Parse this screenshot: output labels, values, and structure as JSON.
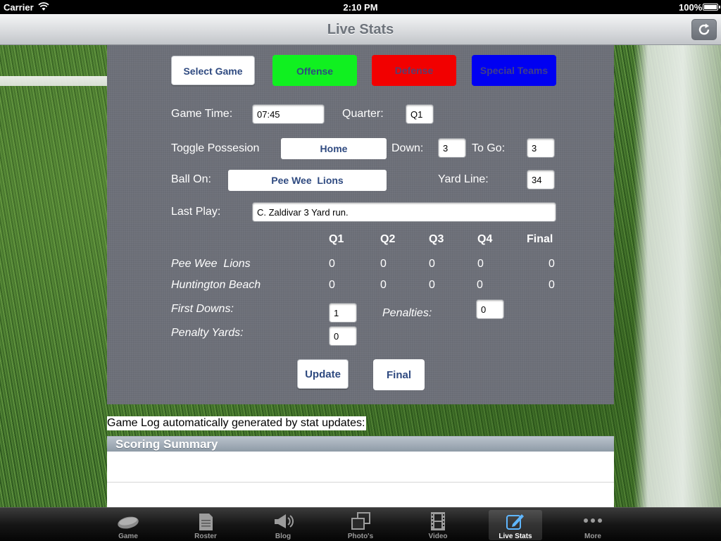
{
  "status_bar": {
    "carrier": "Carrier",
    "time": "2:10 PM",
    "battery": "100%"
  },
  "nav": {
    "title": "Live Stats",
    "refresh_icon": "refresh-icon"
  },
  "top_buttons": {
    "select_game": "Select Game",
    "offense": "Offense",
    "defense": "Defense",
    "special_teams": "Special Teams"
  },
  "colors": {
    "offense": "#10f020",
    "defense": "#f20000",
    "special_teams": "#0000f2"
  },
  "game_info": {
    "game_time_label": "Game Time:",
    "game_time_value": "07:45",
    "quarter_label": "Quarter:",
    "quarter_value": "Q1",
    "possession_label": "Toggle Possesion",
    "possession_value": "Home",
    "down_label": "Down:",
    "down_value": "3",
    "to_go_label": "To Go:",
    "to_go_value": "3",
    "ball_on_label": "Ball On:",
    "ball_on_value": "Pee Wee  Lions",
    "yard_line_label": "Yard Line:",
    "yard_line_value": "34",
    "last_play_label": "Last Play:",
    "last_play_value": "C. Zaldivar 3 Yard run."
  },
  "scoreboard": {
    "headers": [
      "Q1",
      "Q2",
      "Q3",
      "Q4",
      "Final"
    ],
    "teams": [
      {
        "name": "Pee Wee  Lions",
        "scores": [
          "0",
          "0",
          "0",
          "0",
          "0"
        ]
      },
      {
        "name": "Huntington Beach",
        "scores": [
          "0",
          "0",
          "0",
          "0",
          "0"
        ]
      }
    ]
  },
  "team_stats": {
    "first_downs_label": "First Downs:",
    "first_downs_value": "1",
    "penalties_label": "Penalties:",
    "penalties_value": "0",
    "penalty_yards_label": "Penalty Yards:",
    "penalty_yards_value": "0"
  },
  "actions": {
    "update": "Update",
    "final": "Final"
  },
  "game_log": {
    "caption": "Game Log automatically generated by stat updates:",
    "section_title": "Scoring Summary"
  },
  "tab_bar": {
    "items": [
      {
        "label": "Game",
        "icon": "football-icon"
      },
      {
        "label": "Roster",
        "icon": "document-icon"
      },
      {
        "label": "Blog",
        "icon": "megaphone-icon"
      },
      {
        "label": "Photo's",
        "icon": "photos-icon"
      },
      {
        "label": "Video",
        "icon": "film-icon"
      },
      {
        "label": "Live Stats",
        "icon": "edit-icon"
      },
      {
        "label": "More",
        "icon": "more-icon"
      }
    ],
    "active": "Live Stats"
  }
}
